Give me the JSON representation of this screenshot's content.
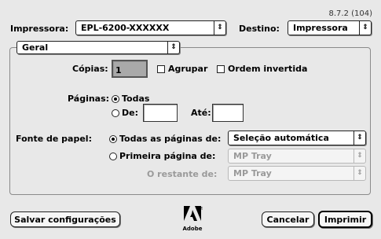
{
  "version": "8.7.2 (104)",
  "printer": {
    "label": "Impressora:",
    "value": "EPL-6200-XXXXXX"
  },
  "destination": {
    "label": "Destino:",
    "value": "Impressora"
  },
  "panel": {
    "value": "Geral"
  },
  "copies": {
    "label": "Cópias:",
    "value": "1"
  },
  "collate": {
    "label": "Agrupar",
    "checked": false
  },
  "reverse_order": {
    "label": "Ordem invertida",
    "checked": false
  },
  "pages": {
    "label": "Páginas:",
    "all_label": "Todas",
    "from_label": "De:",
    "to_label": "Até:",
    "from_value": "",
    "to_value": "",
    "selected": "all"
  },
  "paper_source": {
    "label": "Fonte de papel:",
    "all_pages_label": "Todas as páginas de:",
    "all_pages_value": "Seleção automática",
    "first_page_label": "Primeira página de:",
    "first_page_value": "MP Tray",
    "remaining_label": "O restante de:",
    "remaining_value": "MP Tray",
    "selected": "all_pages"
  },
  "buttons": {
    "save": "Salvar configurações",
    "cancel": "Cancelar",
    "print": "Imprimir"
  },
  "logo": {
    "caption": "Adobe"
  },
  "icons": {
    "popup_arrows": "up-down-arrows-icon"
  }
}
